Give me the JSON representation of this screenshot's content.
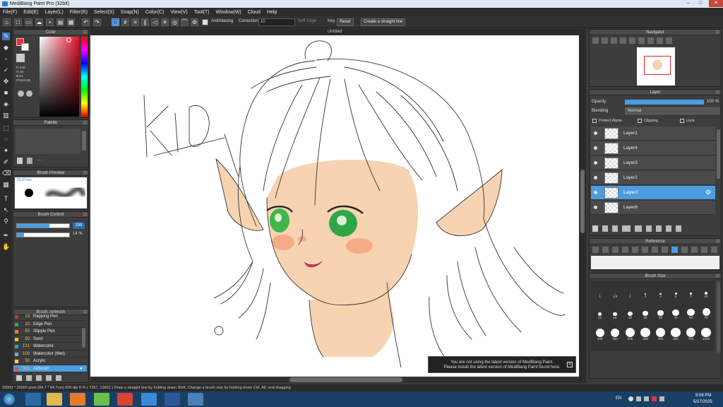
{
  "window": {
    "title": "MediBang Paint Pro (32bit)",
    "controls": [
      "–",
      "□",
      "✕"
    ]
  },
  "menu": [
    "File(F)",
    "Edit(E)",
    "Layer(L)",
    "Filter(R)",
    "Select(S)",
    "Snap(N)",
    "Color(C)",
    "View(V)",
    "Tool(T)",
    "Window(W)",
    "Cloud",
    "Help"
  ],
  "toolbar": {
    "antialiasing": "AntiAliasing",
    "correction_label": "Correction",
    "correction_value": "10",
    "soft_edge": "Soft Edge",
    "key": "Key",
    "reset": "Reset",
    "straight_line": "Create a straight line"
  },
  "canvas": {
    "tab_title": "Untitled",
    "sketch_text": "KID"
  },
  "color_panel": {
    "title": "Color",
    "readout_lines": [
      "R:246",
      "G:42",
      "B:61"
    ],
    "hex": "#F62A3D",
    "colors": {
      "primary": "#F62A3D",
      "secondary": "#FFFFFF"
    }
  },
  "palette_panel": {
    "title": "Palette"
  },
  "brush_preview": {
    "title": "Brush Preview",
    "size": "10.97mm"
  },
  "brush_control": {
    "title": "Brush Control",
    "size_value": "259",
    "opacity_value": "14 %",
    "size_fill": 0.62,
    "opacity_fill": 0.14
  },
  "brush_list": {
    "title": "Brush: Airbrush",
    "items": [
      {
        "size": "13",
        "label": "Rapping Pen",
        "color": "#c0392b"
      },
      {
        "size": "10",
        "label": "Edge Pen",
        "color": "#27ae60"
      },
      {
        "size": "50",
        "label": "Stipple Pen",
        "color": "#e67e22"
      },
      {
        "size": "50",
        "label": "Sumi",
        "color": "#f1c40f"
      },
      {
        "size": "121",
        "label": "Watercolor",
        "color": "#3498db"
      },
      {
        "size": "100",
        "label": "Watercolor (Wet)",
        "color": "#5dade2"
      },
      {
        "size": "50",
        "label": "Acrylic",
        "color": "#f4d03f"
      },
      {
        "size": "300",
        "label": "Airbrush",
        "color": "#e74c3c",
        "selected": true
      }
    ]
  },
  "navigator": {
    "title": "Navigator"
  },
  "layer_panel": {
    "title": "Layer",
    "opacity_label": "Opacity",
    "opacity_value": "100 %",
    "blending_label": "Blending",
    "blending_value": "Normal",
    "protect_alpha": "Protect Alpha",
    "clipping": "Clipping",
    "lock": "Lock",
    "layers": [
      {
        "name": "Layer1",
        "selected": false
      },
      {
        "name": "Layer4",
        "selected": false
      },
      {
        "name": "Layer3",
        "selected": false
      },
      {
        "name": "Layer2",
        "selected": false
      },
      {
        "name": "Layer7",
        "selected": true
      },
      {
        "name": "Layer6",
        "selected": false
      }
    ]
  },
  "reference_panel": {
    "title": "Reference"
  },
  "brush_size_panel": {
    "title": "Brush Size",
    "row1": [
      "1",
      "1.5",
      "2",
      "3",
      "4",
      "5",
      "7",
      "10"
    ],
    "row2": [
      "13",
      "16",
      "20",
      "25",
      "30",
      "40",
      "50",
      "70"
    ],
    "row3": [
      "100",
      "150",
      "200",
      "300",
      "400",
      "500",
      "700",
      "1000"
    ]
  },
  "notice": {
    "line1": "You are not using the latest version of MediBang Paint.",
    "line2": "Please install the latest version of MediBang Paint found here."
  },
  "status": {
    "text": "20000 * 20000 pixel  (84.7 * 84.7cm)  600 dpi  8 %  ( 7367, 13652 )  Draw a straight line by holding down Shift, Change a brush size by holding down Ctrl, Alt, and dragging"
  },
  "taskbar": {
    "lang": "EN",
    "time": "9:09 PM",
    "date": "5/27/2025"
  }
}
